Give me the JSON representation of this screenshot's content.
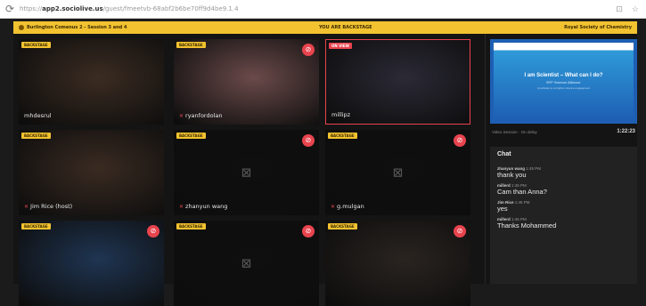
{
  "browser": {
    "url_scheme": "https://",
    "url_host": "app2.sociolive.us",
    "url_path": "/guest/fmeetvb-68abf2b6be70ff9d4be9.1.4"
  },
  "banner": {
    "event": "Burlington Comenus 2 - Session 3 and 4",
    "center": "YOU ARE BACKSTAGE",
    "org": "Royal Society of Chemistry"
  },
  "tiles": [
    {
      "badge": "BACKSTAGE",
      "name": "mhdesrul",
      "live": false,
      "cam_off": false,
      "bg": "#3b2c22"
    },
    {
      "badge": "BACKSTAGE",
      "name": "ryanfordolan",
      "live": false,
      "cam_off": true,
      "bg": "#6b4a4a"
    },
    {
      "badge": "ON VIEW",
      "name": "millipz",
      "live": true,
      "cam_off": false,
      "bg": "#2b2a36"
    },
    {
      "badge": "BACKSTAGE",
      "name": "Jim Rice (host)",
      "live": false,
      "cam_off": false,
      "bg": "#3a2b22"
    },
    {
      "badge": "BACKSTAGE",
      "name": "zhanyun wang",
      "live": false,
      "cam_off": true,
      "bg": "#0f0f0f"
    },
    {
      "badge": "BACKSTAGE",
      "name": "g.mulgan",
      "live": false,
      "cam_off": true,
      "bg": "#0f0f0f"
    },
    {
      "badge": "BACKSTAGE",
      "name": "",
      "live": false,
      "cam_off": true,
      "bg": "#1f3552"
    },
    {
      "badge": "BACKSTAGE",
      "name": "",
      "live": false,
      "cam_off": true,
      "bg": "#0f0f0f"
    },
    {
      "badge": "BACKSTAGE",
      "name": "",
      "live": false,
      "cam_off": true,
      "bg": "#2a2420"
    }
  ],
  "slide": {
    "title": "I am Scientist – What can I do?",
    "subtitle": "SPP Science Alliance:",
    "line": "A pathway to a brighter science engagement"
  },
  "meta": {
    "label": "Video Session · On delay",
    "time": "1:22:23"
  },
  "chat": {
    "title": "Chat",
    "messages": [
      {
        "who": "zhanyun wang",
        "when": "1:45 PM",
        "text": "thank you"
      },
      {
        "who": "millerd",
        "when": "1:45 PM",
        "text": "Cam than Anna?"
      },
      {
        "who": "Jim Rice",
        "when": "1:46 PM",
        "text": "yes"
      },
      {
        "who": "millerd",
        "when": "1:46 PM",
        "text": "Thanks Mohammed"
      }
    ]
  },
  "icons": {
    "cam_off": "video-off-icon",
    "mic": "mic-icon",
    "reload": "reload-icon"
  },
  "colors": {
    "accent": "#f2c230",
    "alert": "#e8444e",
    "background": "#1b1b1b"
  }
}
